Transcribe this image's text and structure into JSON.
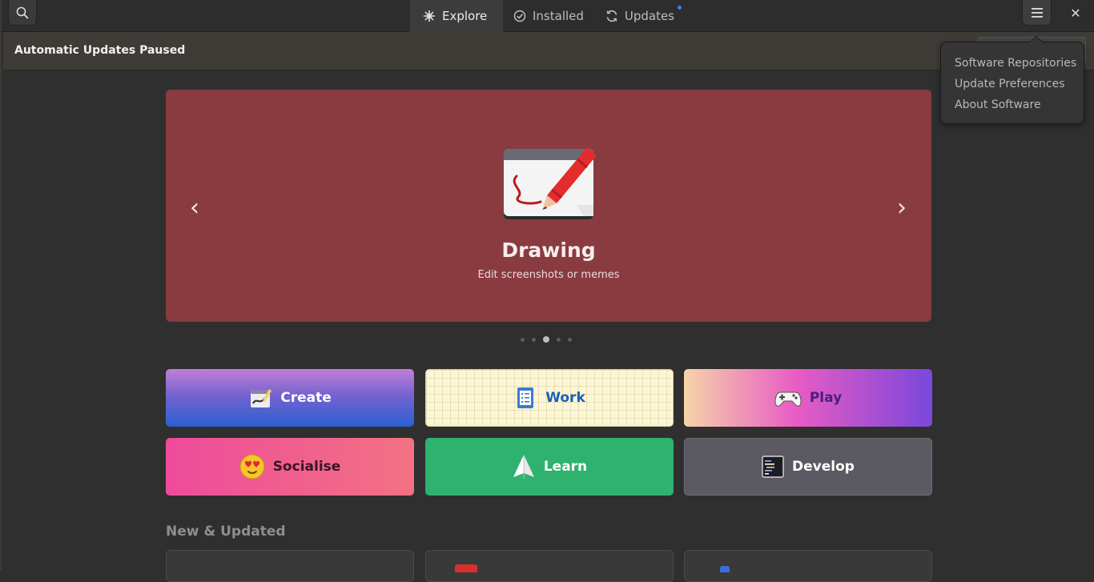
{
  "header": {
    "tabs": [
      {
        "label": "Explore",
        "icon": "explore-icon",
        "active": true
      },
      {
        "label": "Installed",
        "icon": "installed-icon",
        "active": false
      },
      {
        "label": "Updates",
        "icon": "updates-icon",
        "active": false,
        "badge": true
      }
    ],
    "search_icon": "search-icon",
    "menu_icon": "hamburger-menu-icon",
    "close_glyph": "✕"
  },
  "infobar": {
    "text": "Automatic Updates Paused"
  },
  "menu_popover": {
    "items": [
      "Software Repositories",
      "Update Preferences",
      "About Software"
    ]
  },
  "featured": {
    "title": "Drawing",
    "subtitle": "Edit screenshots or memes",
    "prev_glyph": "‹",
    "next_glyph": "›",
    "page_count": 5,
    "current_page": 3,
    "background": "#8a3b40"
  },
  "categories": [
    {
      "label": "Create",
      "icon": "create-icon"
    },
    {
      "label": "Work",
      "icon": "work-icon"
    },
    {
      "label": "Play",
      "icon": "gamepad-icon"
    },
    {
      "label": "Socialise",
      "icon": "smiley-icon"
    },
    {
      "label": "Learn",
      "icon": "paper-plane-icon"
    },
    {
      "label": "Develop",
      "icon": "terminal-icon"
    }
  ],
  "new_updated": {
    "title": "New & Updated"
  },
  "colors": {
    "accent": "#3584e4",
    "window_bg": "#2f2f2f",
    "infobar_bg": "#3f3b37"
  }
}
